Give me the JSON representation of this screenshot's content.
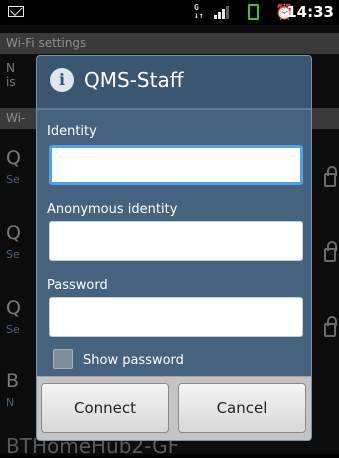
{
  "statusbar": {
    "time": "14:33",
    "data_indicator": "G"
  },
  "background": {
    "section_wifi_settings": "Wi-Fi settings",
    "section_wifi_networks": "Wi-",
    "row_partial_1": "N",
    "row_partial_1b": "is",
    "networks": [
      {
        "letter": "Q",
        "sub": "Se"
      },
      {
        "letter": "Q",
        "sub": "Se"
      },
      {
        "letter": "Q",
        "sub": "Se"
      },
      {
        "letter": "B",
        "sub": "N"
      }
    ],
    "bottom_network": "BTHomeHub2-GF"
  },
  "dialog": {
    "title": "QMS-Staff",
    "identity_label": "Identity",
    "identity_value": "",
    "anonymous_label": "Anonymous identity",
    "anonymous_value": "",
    "password_label": "Password",
    "password_value": "",
    "show_password_label": "Show password",
    "connect_label": "Connect",
    "cancel_label": "Cancel"
  },
  "colors": {
    "dialog_bg": "#45627f",
    "focus": "#4fa3e8"
  }
}
